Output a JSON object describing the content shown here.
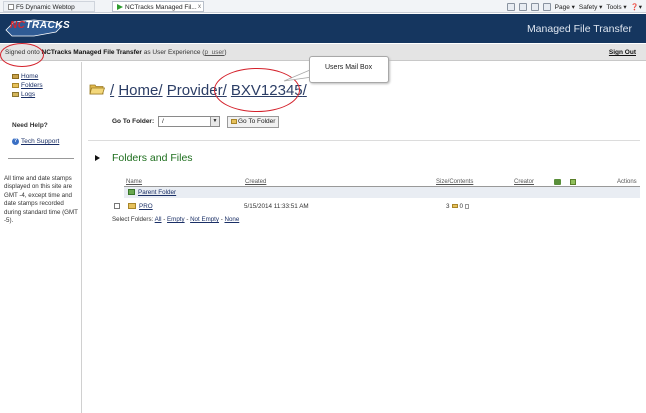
{
  "browser": {
    "tabs": [
      {
        "label": "F5 Dynamic Webtop"
      },
      {
        "label": "NCTracks Managed Fil..."
      }
    ],
    "tab_close": "x",
    "toolbar": {
      "page": "Page ▾",
      "safety": "Safety ▾",
      "tools": "Tools ▾",
      "help": "❓▾"
    }
  },
  "header": {
    "logo_nc": "NC",
    "logo_rest": "TRACKS",
    "title": "Managed File Transfer"
  },
  "signbar": {
    "prefix": "Signed onto ",
    "app": "NCTracks Managed File Transfer",
    "middle": " as User Experience (",
    "user": "p_user",
    "suffix": ")",
    "signout": "Sign Out"
  },
  "sidebar": {
    "items": [
      {
        "label": "Home"
      },
      {
        "label": "Folders"
      },
      {
        "label": "Logs"
      }
    ],
    "need_help": "Need Help?",
    "tech_support": "Tech Support",
    "time_note": "All time and date stamps displayed on this site are GMT -4, except time and date stamps recorded during standard time (GMT -5)."
  },
  "main": {
    "path_sep": "/",
    "path_home": "Home",
    "path_provider": "Provider",
    "path_mailbox": "BXV12345",
    "callout": "Users Mail Box",
    "goto_label": "Go To Folder:",
    "goto_value": "/",
    "goto_button": "Go To Folder",
    "section_title": "Folders and Files",
    "columns": {
      "name": "Name",
      "created": "Created",
      "size": "Size/Contents",
      "creator": "Creator",
      "actions": "Actions"
    },
    "parent_folder": "Parent Folder",
    "row": {
      "name": "PRO",
      "created": "5/15/2014 11:33:51 AM",
      "folders": "3",
      "files": "0"
    },
    "select_folders": {
      "label": "Select Folders: ",
      "all": "All",
      "empty": "Empty",
      "not_empty": "Not Empty",
      "none": "None",
      "sep": " - "
    }
  }
}
